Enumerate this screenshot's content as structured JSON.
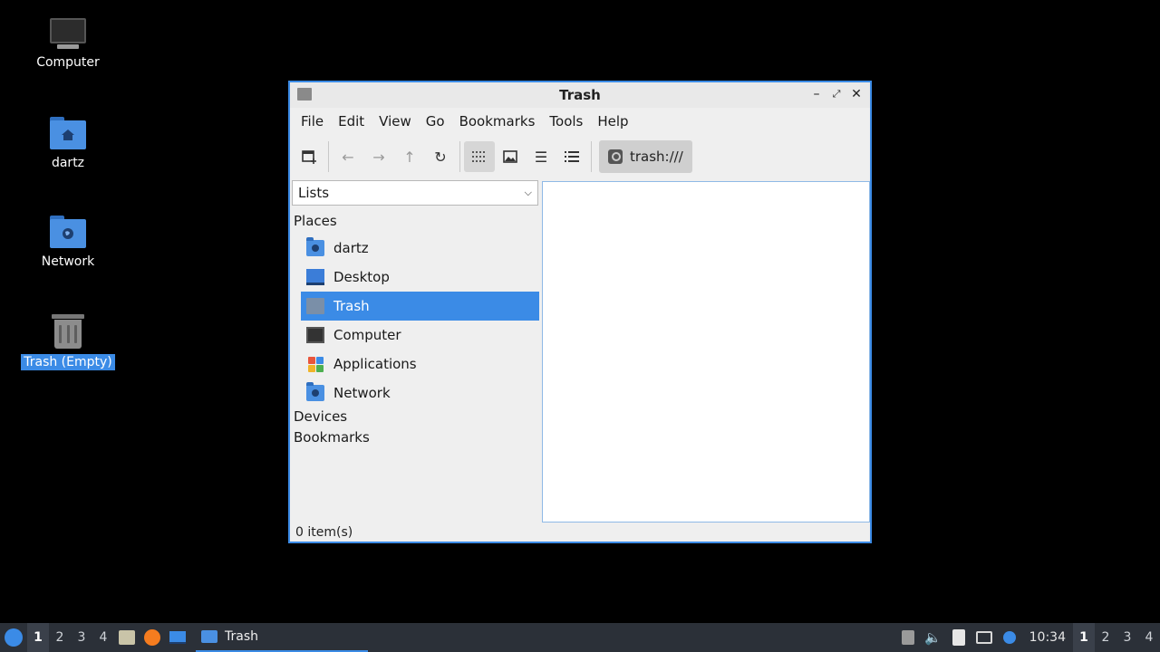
{
  "desktop": {
    "icons": [
      {
        "label": "Computer"
      },
      {
        "label": "dartz"
      },
      {
        "label": "Network"
      },
      {
        "label": "Trash (Empty)"
      }
    ]
  },
  "window": {
    "title": "Trash",
    "menu": [
      "File",
      "Edit",
      "View",
      "Go",
      "Bookmarks",
      "Tools",
      "Help"
    ],
    "toolbar": {
      "new_tab_icon": "new-tab-icon",
      "path": "trash:///"
    },
    "side": {
      "dropdown_value": "Lists",
      "places_heading": "Places",
      "places": [
        {
          "label": "dartz",
          "icon": "home-folder-icon"
        },
        {
          "label": "Desktop",
          "icon": "desktop-icon"
        },
        {
          "label": "Trash",
          "icon": "trash-icon",
          "selected": true
        },
        {
          "label": "Computer",
          "icon": "computer-icon"
        },
        {
          "label": "Applications",
          "icon": "applications-icon"
        },
        {
          "label": "Network",
          "icon": "network-icon"
        }
      ],
      "devices_heading": "Devices",
      "bookmarks_heading": "Bookmarks"
    },
    "status": "0 item(s)"
  },
  "taskbar": {
    "workspaces": [
      "1",
      "2",
      "3",
      "4"
    ],
    "active_workspace": "1",
    "task_label": "Trash",
    "clock": "10:34",
    "workspaces_right": [
      "1",
      "2",
      "3",
      "4"
    ]
  },
  "colors": {
    "accent": "#3b8be6",
    "taskbar_bg": "#2b3038",
    "folder_blue": "#4a90e2"
  }
}
